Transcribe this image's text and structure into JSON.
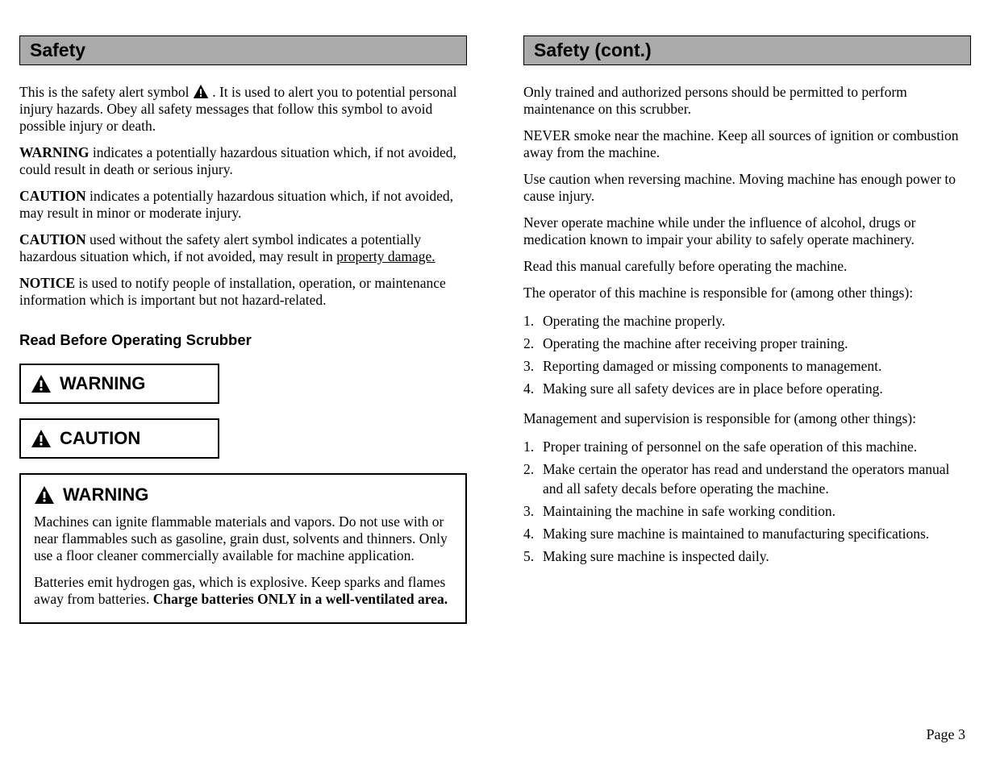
{
  "left": {
    "section_title": "Safety",
    "intro_p1_prefix": "This is the safety alert symbol ",
    "intro_p1_suffix": ". It is used to alert you to potential personal injury hazards. Obey all safety messages that follow this symbol to avoid possible injury or death.",
    "warning_def_prefix_bold": "WARNING",
    "warning_def_text": " indicates a potentially hazardous situation which, if not avoided, could result in death or serious injury.",
    "caution_def_prefix_bold": "CAUTION",
    "caution_def_text": " indicates a potentially hazardous situation which, if not avoided, may result in minor or moderate injury.",
    "caution_noalert_prefix_bold": "CAUTION",
    "caution_noalert_text_before_underline": " used without the safety alert symbol indicates a potentially hazardous situation which, if not avoided, may result in ",
    "caution_noalert_underlined": "property damage.",
    "notice_prefix_bold": "NOTICE",
    "notice_text": " is used to notify people of installation, operation, or maintenance information which is important but not hazard-related.",
    "subhead": "Read Before Operating Scrubber",
    "warning_label": "WARNING",
    "caution_label": "CAUTION",
    "wideWarning": {
      "label": "WARNING",
      "p1": "Machines can ignite flammable materials and vapors. Do not use with or near flammables such as gasoline, grain dust, solvents and thinners. Only use a floor cleaner commercially available for machine application.",
      "p2_before_bold": "Batteries emit hydrogen gas, which is explosive. Keep sparks and flames away from batteries. ",
      "p2_bold": "Charge batteries ONLY in a well-ventilated area."
    }
  },
  "right": {
    "section_title": "Safety (cont.)",
    "p1": "Only trained and authorized persons should be permitted to perform maintenance on this scrubber.",
    "p2": "NEVER smoke near the machine. Keep all sources of ignition or combustion away from the machine.",
    "p3": "Use caution when reversing machine. Moving machine has enough power to cause injury.",
    "p4": "Never operate machine while under the influence of alcohol, drugs or medication known to impair your ability to safely operate machinery.",
    "p5": "Read this manual carefully before operating the machine.",
    "operator_intro": "The operator of this machine is responsible for (among other things):",
    "operator_list": [
      "Operating the machine properly.",
      "Operating the machine after receiving proper training.",
      "Reporting damaged or missing components to management.",
      "Making sure all safety devices are in place before operating."
    ],
    "management_intro": "Management and supervision is responsible for (among other things):",
    "management_list": [
      "Proper training of personnel on the safe operation of this machine.",
      "Make certain the operator has read and understand the operators manual and all safety decals before operating the machine.",
      "Maintaining the machine in safe working condition.",
      "Making sure machine is maintained to manufacturing specifications.",
      "Making sure machine is inspected daily."
    ]
  },
  "page_label": "Page 3"
}
